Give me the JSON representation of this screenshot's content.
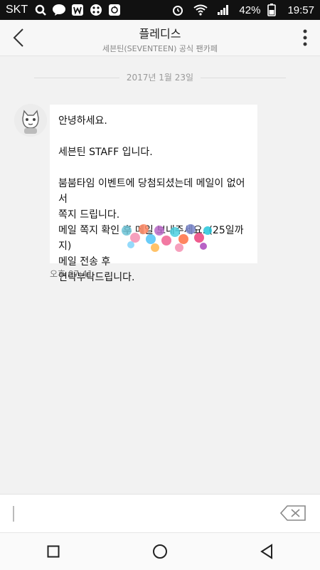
{
  "status": {
    "carrier": "SKT",
    "battery_text": "42%",
    "time": "19:57"
  },
  "header": {
    "title": "플레디스",
    "subtitle": "세븐틴(SEVENTEEN) 공식 팬카페"
  },
  "conversation": {
    "date": "2017년 1월 23일",
    "message": {
      "lines": [
        "안녕하세요.",
        "",
        "세븐틴 STAFF 입니다.",
        "",
        "붐붐타임 이벤트에 당첨되셨는데 메일이 없어서",
        "쪽지 드립니다.",
        "메일 쪽지 확인 후 메일 보내주세요. (25일까지)",
        "메일 전송 후",
        "연락부탁드립니다."
      ],
      "time": "오후 07:41"
    }
  },
  "colors": {
    "statusbar_bg": "#111111",
    "background": "#f2f2f2"
  }
}
